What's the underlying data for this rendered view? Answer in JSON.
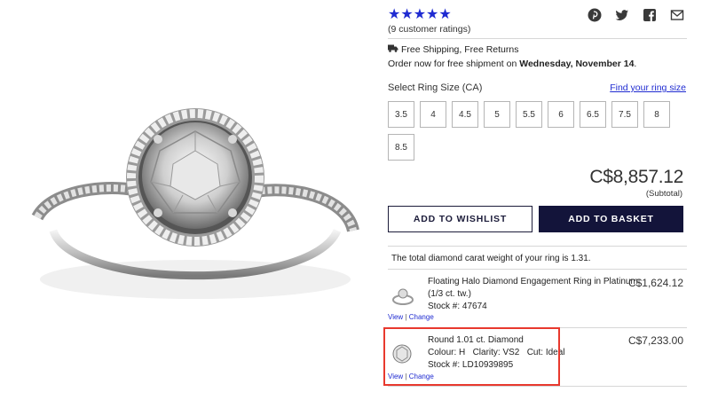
{
  "product": {
    "rating": {
      "stars": 5,
      "stars_glyph": "★★★★★",
      "count_text": "(9 customer ratings)",
      "color": "#1f2bd1"
    },
    "share_icons": [
      "pinterest-icon",
      "twitter-icon",
      "facebook-icon",
      "email-icon"
    ],
    "shipping": {
      "line1": "Free Shipping, Free Returns",
      "order_prefix": "Order now for free shipment on ",
      "order_date": "Wednesday, November 14",
      "order_suffix": "."
    },
    "ring_size": {
      "label": "Select Ring Size (CA)",
      "guide_link": "Find your ring size",
      "options": [
        "3.5",
        "4",
        "4.5",
        "5",
        "5.5",
        "6",
        "6.5",
        "7.5",
        "8",
        "8.5"
      ]
    },
    "price": "C$8,857.12",
    "subtotal_label": "(Subtotal)",
    "buttons": {
      "wishlist": "ADD TO WISHLIST",
      "basket": "ADD TO BASKET"
    },
    "carat_note": "The total diamond carat weight of your ring is 1.31.",
    "items": [
      {
        "line1": "Floating Halo Diamond Engagement Ring in Platinum",
        "line2": "(1/3 ct. tw.)",
        "line3": "Stock #: 47674",
        "price": "C$1,624.12",
        "view": "View",
        "sep": "|",
        "change": "Change"
      },
      {
        "line1": "Round 1.01 ct. Diamond",
        "line2": "Colour: H   Clarity: VS2   Cut: Ideal",
        "line3": "Stock #: LD10939895",
        "price": "C$7,233.00",
        "view": "View",
        "sep": "|",
        "change": "Change"
      }
    ]
  },
  "colors": {
    "accent_blue": "#1f2bd1",
    "navy_button": "#13143a",
    "highlight_red": "#e8392e"
  }
}
